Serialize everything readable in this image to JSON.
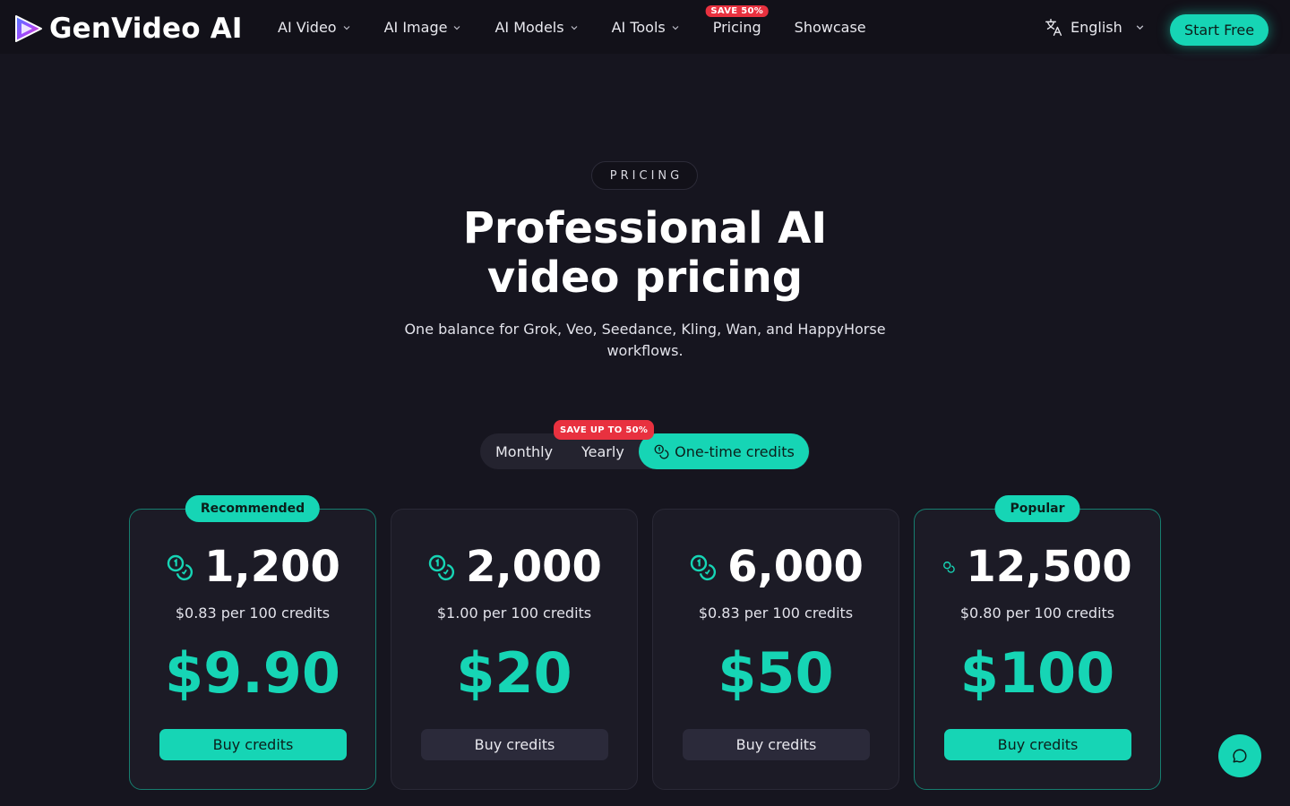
{
  "header": {
    "brand": "GenVideo AI",
    "nav": [
      {
        "label": "AI Video",
        "dropdown": true
      },
      {
        "label": "AI Image",
        "dropdown": true
      },
      {
        "label": "AI Models",
        "dropdown": true
      },
      {
        "label": "AI Tools",
        "dropdown": true
      },
      {
        "label": "Pricing",
        "badge": "SAVE 50%"
      },
      {
        "label": "Showcase"
      }
    ],
    "language": "English",
    "cta": "Start Free"
  },
  "hero": {
    "eyebrow": "PRICING",
    "title_line1": "Professional AI",
    "title_line2": "video pricing",
    "subtitle": "One balance for Grok, Veo, Seedance, Kling, Wan, and HappyHorse workflows."
  },
  "billing_toggle": {
    "monthly": "Monthly",
    "yearly": "Yearly",
    "one_time": "One-time credits",
    "save_badge": "SAVE UP TO 50%",
    "active": "one_time"
  },
  "plans": [
    {
      "badge": "Recommended",
      "credits": "1,200",
      "per": "$0.83 per 100 credits",
      "price": "$9.90",
      "button": "Buy credits"
    },
    {
      "badge": "",
      "credits": "2,000",
      "per": "$1.00 per 100 credits",
      "price": "$20",
      "button": "Buy credits"
    },
    {
      "badge": "",
      "credits": "6,000",
      "per": "$0.83 per 100 credits",
      "price": "$50",
      "button": "Buy credits"
    },
    {
      "badge": "Popular",
      "credits": "12,500",
      "per": "$0.80 per 100 credits",
      "price": "$100",
      "button": "Buy credits"
    }
  ],
  "colors": {
    "accent": "#16d5b5",
    "background": "#16151f",
    "badge_red": "#e8313f"
  }
}
